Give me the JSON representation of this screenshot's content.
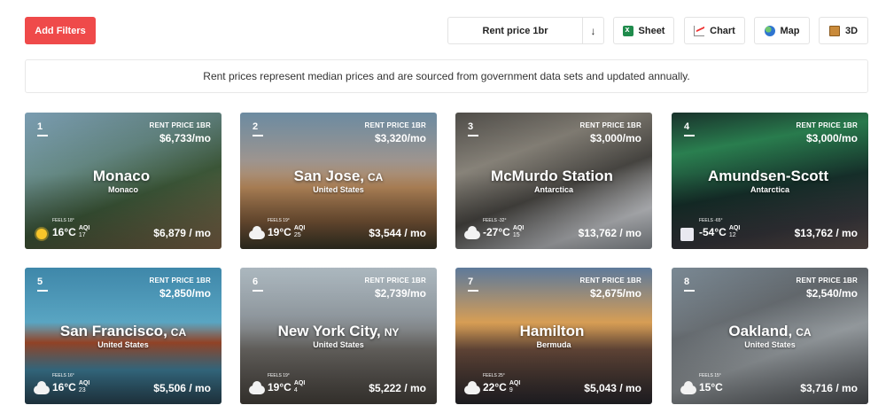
{
  "toolbar": {
    "add_filters": "Add Filters",
    "sort_label": "Rent price 1br",
    "sort_arrow": "↓",
    "sheet": "Sheet",
    "chart": "Chart",
    "map": "Map",
    "three_d": "3D"
  },
  "banner": "Rent prices represent median prices and are sourced from government data sets and updated annually.",
  "card_rent_label": "RENT PRICE 1BR",
  "cards": [
    {
      "rank": "1",
      "rent": "$6,733/mo",
      "city": "Monaco",
      "state": "",
      "country": "Monaco",
      "weather": "sun",
      "feels": "FEELS 18°",
      "temp": "16°C",
      "aqi_label": "AQI",
      "aqi": "17",
      "cost": "$6,879 / mo"
    },
    {
      "rank": "2",
      "rent": "$3,320/mo",
      "city": "San Jose,",
      "state": "CA",
      "country": "United States",
      "weather": "cloud",
      "feels": "FEELS 19°",
      "temp": "19°C",
      "aqi_label": "AQI",
      "aqi": "25",
      "cost": "$3,544 / mo"
    },
    {
      "rank": "3",
      "rent": "$3,000/mo",
      "city": "McMurdo Station",
      "state": "",
      "country": "Antarctica",
      "weather": "cloud",
      "feels": "FEELS -32°",
      "temp": "-27°C",
      "aqi_label": "AQI",
      "aqi": "15",
      "cost": "$13,762 / mo"
    },
    {
      "rank": "4",
      "rent": "$3,000/mo",
      "city": "Amundsen-Scott",
      "state": "",
      "country": "Antarctica",
      "weather": "snow",
      "feels": "FEELS -65°",
      "temp": "-54°C",
      "aqi_label": "AQI",
      "aqi": "12",
      "cost": "$13,762 / mo"
    },
    {
      "rank": "5",
      "rent": "$2,850/mo",
      "city": "San Francisco,",
      "state": "CA",
      "country": "United States",
      "weather": "cloud",
      "feels": "FEELS 16°",
      "temp": "16°C",
      "aqi_label": "AQI",
      "aqi": "23",
      "cost": "$5,506 / mo"
    },
    {
      "rank": "6",
      "rent": "$2,739/mo",
      "city": "New York City,",
      "state": "NY",
      "country": "United States",
      "weather": "cloud",
      "feels": "FEELS 19°",
      "temp": "19°C",
      "aqi_label": "AQI",
      "aqi": "4",
      "cost": "$5,222 / mo"
    },
    {
      "rank": "7",
      "rent": "$2,675/mo",
      "city": "Hamilton",
      "state": "",
      "country": "Bermuda",
      "weather": "cloud",
      "feels": "FEELS 25°",
      "temp": "22°C",
      "aqi_label": "AQI",
      "aqi": "9",
      "cost": "$5,043 / mo"
    },
    {
      "rank": "8",
      "rent": "$2,540/mo",
      "city": "Oakland,",
      "state": "CA",
      "country": "United States",
      "weather": "cloud",
      "feels": "FEELS 15°",
      "temp": "15°C",
      "aqi_label": "",
      "aqi": "",
      "cost": "$3,716 / mo"
    }
  ]
}
